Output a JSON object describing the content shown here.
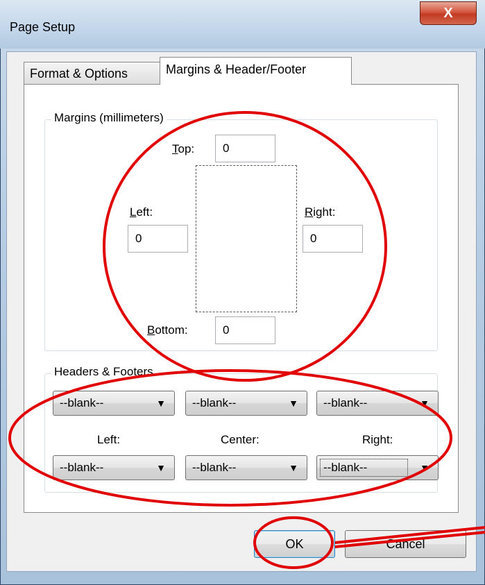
{
  "window": {
    "title": "Page Setup",
    "close_label": "X"
  },
  "tabs": [
    {
      "label": "Format & Options",
      "active": false
    },
    {
      "label": "Margins & Header/Footer",
      "active": true
    }
  ],
  "margins": {
    "group_label": "Margins (millimeters)",
    "top": {
      "accel": "T",
      "rest": "op:",
      "value": "0"
    },
    "left": {
      "accel": "L",
      "rest": "eft:",
      "value": "0"
    },
    "right": {
      "accel": "R",
      "rest": "ight:",
      "value": "0"
    },
    "bottom": {
      "accel": "B",
      "rest": "ottom:",
      "value": "0"
    }
  },
  "headers_footers": {
    "group_label": "Headers & Footers",
    "header": {
      "left": "--blank--",
      "center": "--blank--",
      "right": "--blank--"
    },
    "column_labels": {
      "left": "Left:",
      "center": "Center:",
      "right": "Right:"
    },
    "footer": {
      "left": "--blank--",
      "center": "--blank--",
      "right": "--blank--"
    }
  },
  "buttons": {
    "ok": "OK",
    "cancel": "Cancel"
  },
  "annotation": {
    "color": "#e00000"
  }
}
